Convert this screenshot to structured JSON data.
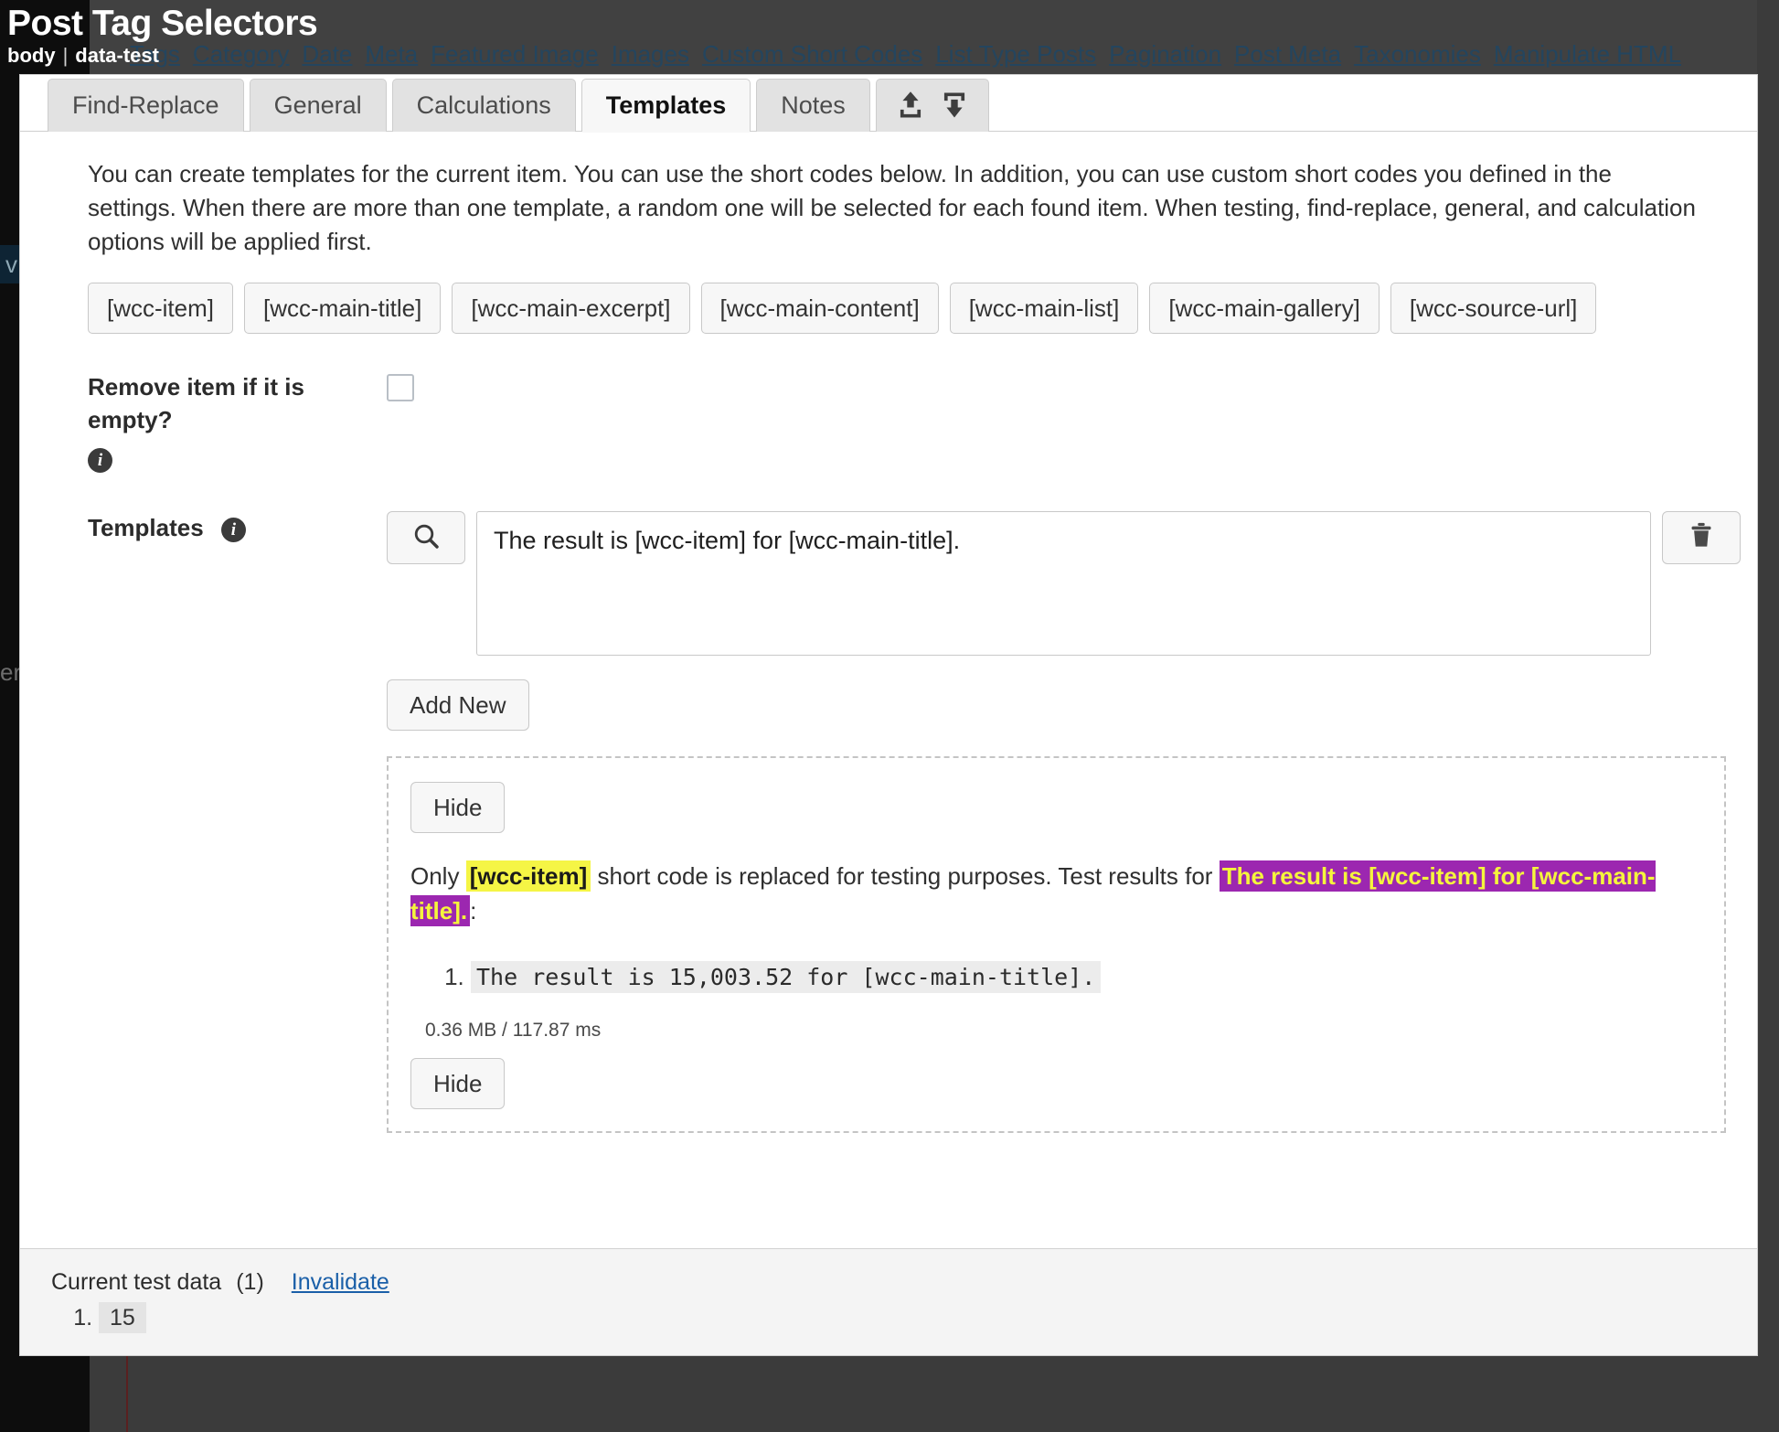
{
  "tooltip": {
    "title": "Post Tag Selectors",
    "element": "body",
    "separator": "|",
    "attribute": "data-test"
  },
  "topnav": {
    "links": [
      "Tags",
      "Category",
      "Date",
      "Meta",
      "Featured Image",
      "Images",
      "Custom Short Codes",
      "List Type Posts",
      "Pagination",
      "Post Meta",
      "Taxonomies",
      "Manipulate HTML"
    ]
  },
  "tabs": [
    {
      "label": "Find-Replace",
      "active": false
    },
    {
      "label": "General",
      "active": false
    },
    {
      "label": "Calculations",
      "active": false
    },
    {
      "label": "Templates",
      "active": true
    },
    {
      "label": "Notes",
      "active": false
    }
  ],
  "icon_tab": {
    "import_icon": "upload-icon",
    "export_icon": "download-icon"
  },
  "intro": "You can create templates for the current item. You can use the short codes below. In addition, you can use custom short codes you defined in the settings. When there are more than one template, a random one will be selected for each found item. When testing, find-replace, general, and calculation options will be applied first.",
  "shortcodes": [
    "[wcc-item]",
    "[wcc-main-title]",
    "[wcc-main-excerpt]",
    "[wcc-main-content]",
    "[wcc-main-list]",
    "[wcc-main-gallery]",
    "[wcc-source-url]"
  ],
  "remove_empty": {
    "label": "Remove item if it is empty?",
    "checked": false,
    "info_icon": "info-icon"
  },
  "templates": {
    "label": "Templates",
    "info_icon": "info-icon",
    "search_icon": "search-icon",
    "delete_icon": "trash-icon",
    "value": "The result is [wcc-item] for [wcc-main-title].",
    "placeholder": "",
    "add_new_label": "Add New"
  },
  "results": {
    "hide_label_top": "Hide",
    "hide_label_bottom": "Hide",
    "intro_pre": "Only ",
    "highlight_shortcode": "[wcc-item]",
    "intro_mid": " short code is replaced for testing purposes. Test results for ",
    "highlight_template": "The result is [wcc-item] for [wcc-main-title].",
    "intro_post": ":",
    "items": [
      "The result is 15,003.52 for [wcc-main-title]."
    ],
    "stats": "0.36 MB / 117.87 ms"
  },
  "bottom": {
    "label": "Current test data",
    "count": "(1)",
    "invalidate_label": "Invalidate",
    "items": [
      "15"
    ]
  },
  "colors": {
    "accent_link": "#1a5fa8",
    "highlight_yellow": "#f5f545",
    "highlight_purple": "#9c27b0",
    "highlight_purple_text": "#f5f53c",
    "panel_bg": "#ffffff",
    "chrome_bg": "#3f3f3f"
  }
}
